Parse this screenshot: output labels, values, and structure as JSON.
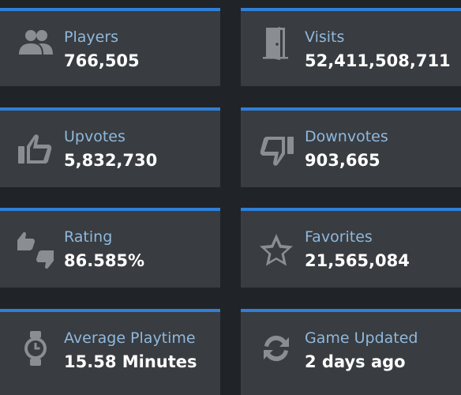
{
  "stats": [
    {
      "label": "Players",
      "value": "766,505",
      "icon": "players-icon"
    },
    {
      "label": "Visits",
      "value": "52,411,508,711",
      "icon": "door-icon"
    },
    {
      "label": "Upvotes",
      "value": "5,832,730",
      "icon": "thumbs-up-icon"
    },
    {
      "label": "Downvotes",
      "value": "903,665",
      "icon": "thumbs-down-icon"
    },
    {
      "label": "Rating",
      "value": "86.585%",
      "icon": "thumbs-up-down-icon"
    },
    {
      "label": "Favorites",
      "value": "21,565,084",
      "icon": "star-icon"
    },
    {
      "label": "Average Playtime",
      "value": "15.58 Minutes",
      "icon": "watch-icon"
    },
    {
      "label": "Game Updated",
      "value": "2 days ago",
      "icon": "refresh-icon"
    }
  ],
  "colors": {
    "background": "#202328",
    "card": "#393c40",
    "accent": "#2f7fd6",
    "label": "#8fb8dd",
    "value": "#ffffff",
    "icon": "#8a8d91"
  }
}
